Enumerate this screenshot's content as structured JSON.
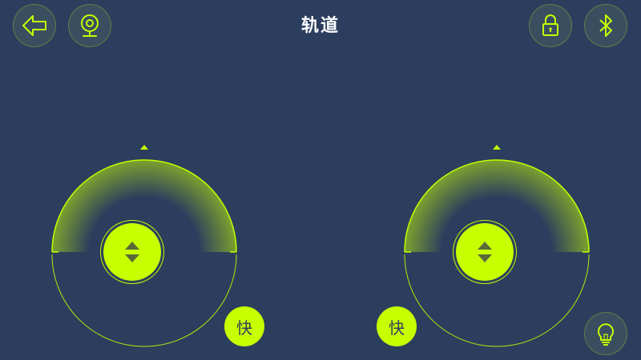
{
  "header": {
    "title": "轨道",
    "back_icon": "arrow-left-icon",
    "camera_icon": "webcam-icon",
    "lock_icon": "lock-icon",
    "bluetooth_icon": "bluetooth-icon"
  },
  "joysticks": [
    {
      "side": "left",
      "knob_icon": "up-down-arrows-icon",
      "speed_label": "快"
    },
    {
      "side": "right",
      "knob_icon": "up-down-arrows-icon",
      "speed_label": "快"
    }
  ],
  "footer": {
    "light_icon": "light-bulb-icon"
  },
  "colors": {
    "background": "#2c3e5e",
    "accent": "#c7ff00",
    "text": "#ffffff"
  }
}
